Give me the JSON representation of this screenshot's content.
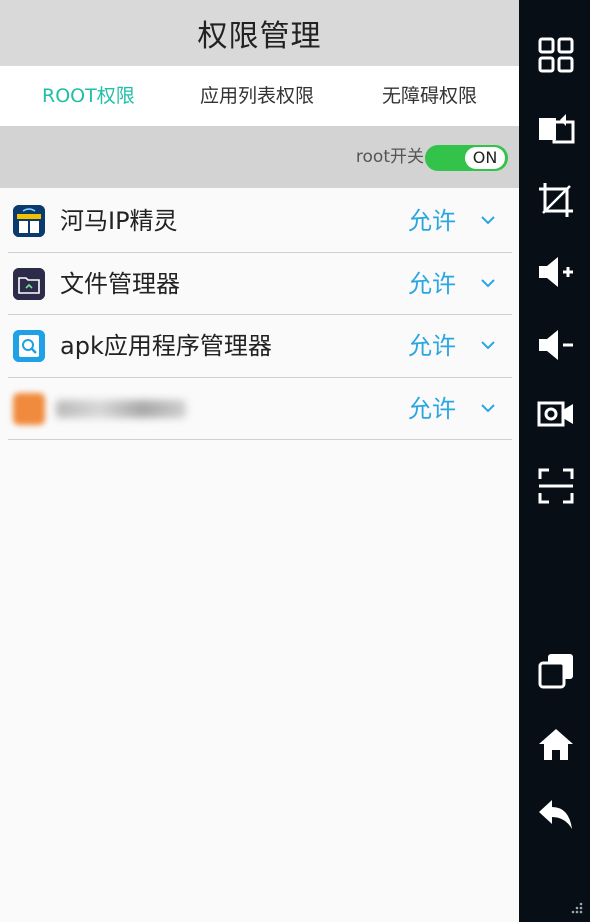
{
  "header": {
    "title": "权限管理"
  },
  "tabs": [
    {
      "label": "ROOT权限",
      "active": true
    },
    {
      "label": "应用列表权限",
      "active": false
    },
    {
      "label": "无障碍权限",
      "active": false
    }
  ],
  "root_switch": {
    "label": "root开关",
    "state": "ON"
  },
  "apps": [
    {
      "name": "河马IP精灵",
      "permission": "允许",
      "icon": "hippo-ip-app-icon"
    },
    {
      "name": "文件管理器",
      "permission": "允许",
      "icon": "file-manager-app-icon"
    },
    {
      "name": "apk应用程序管理器",
      "permission": "允许",
      "icon": "apk-manager-app-icon"
    },
    {
      "name": "",
      "permission": "允许",
      "icon": "blurred-app-icon"
    }
  ],
  "sidebar": {
    "items": [
      "grid-icon",
      "switch-window-icon",
      "crop-icon",
      "volume-up-icon",
      "volume-down-icon",
      "video-record-icon",
      "scan-icon",
      "copy-icon",
      "home-icon",
      "back-icon"
    ]
  },
  "colors": {
    "accent": "#1fbfa8",
    "permission": "#2aa7e0",
    "toggle_on": "#33c24a",
    "sidebar_bg": "#070e16"
  }
}
